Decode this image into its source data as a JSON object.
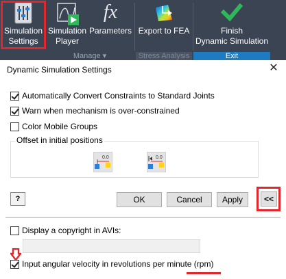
{
  "ribbon": {
    "buttons": {
      "simulation_settings": {
        "line1": "Simulation",
        "line2": "Settings"
      },
      "simulation_player": {
        "line1": "Simulation",
        "line2": "Player"
      },
      "parameters": {
        "line1": "Parameters",
        "icon": "fx-icon",
        "icon_text": "fx"
      },
      "export_fea": {
        "line1": "Export to FEA"
      },
      "finish": {
        "line1": "Finish",
        "line2": "Dynamic Simulation"
      }
    },
    "groups": {
      "manage": "Manage ▾",
      "stress": "Stress Analysis",
      "exit": "Exit"
    },
    "colors": {
      "background": "#3b4453",
      "exit_accent": "#1f7bc1",
      "highlight": "#e2262c"
    }
  },
  "dialog": {
    "title": "Dynamic Simulation Settings",
    "close_glyph": "✕",
    "options": {
      "auto_convert": {
        "label": "Automatically Convert Constraints to Standard Joints",
        "checked": true
      },
      "warn_overconstrained": {
        "label": "Warn when mechanism is over-constrained",
        "checked": true
      },
      "color_mobile": {
        "label": "Color Mobile Groups",
        "checked": false
      }
    },
    "offset_group": {
      "label": "Offset in initial positions",
      "value_text_1": "0.0",
      "value_text_2": "0.0"
    },
    "buttons": {
      "help": "?",
      "ok": "OK",
      "cancel": "Cancel",
      "apply": "Apply",
      "collapse": "<<"
    },
    "extended": {
      "copyright": {
        "label": "Display a copyright in AVIs:",
        "checked": false,
        "value": ""
      },
      "rpm": {
        "label": "Input angular velocity in revolutions per minute (rpm)",
        "checked": true
      }
    }
  }
}
